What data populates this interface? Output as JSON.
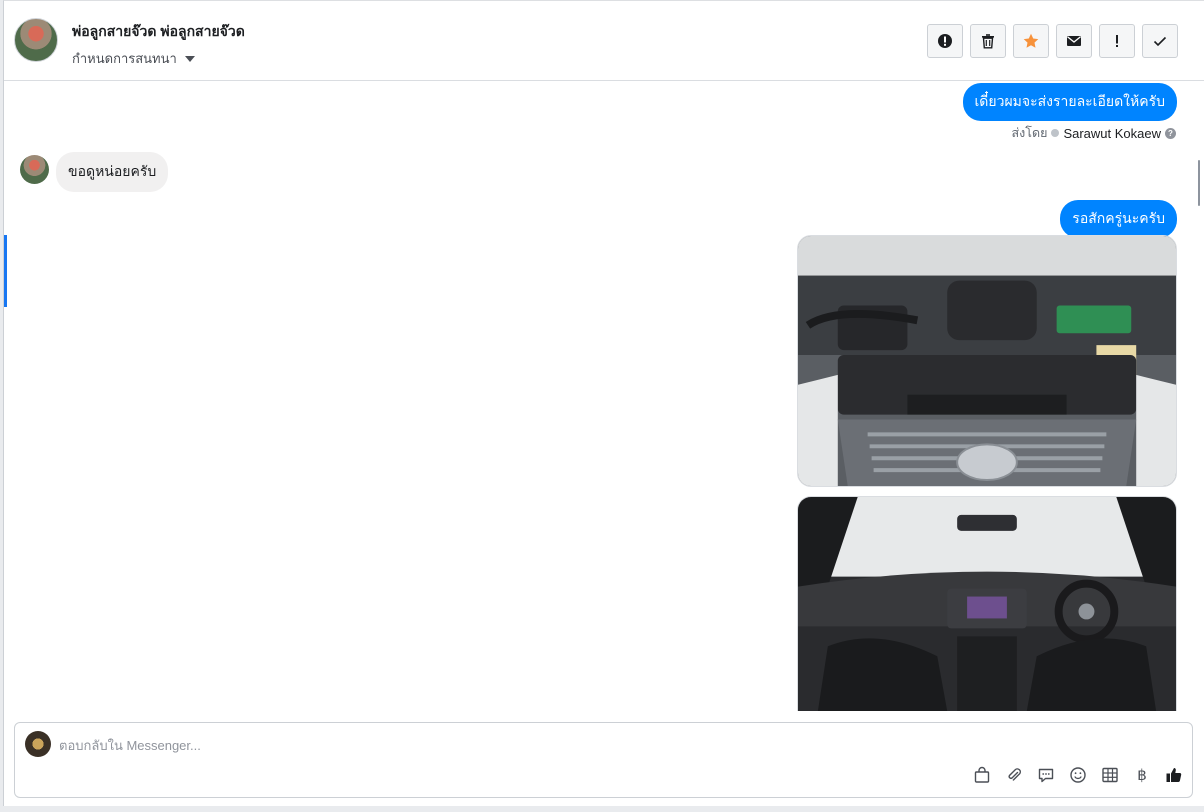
{
  "header": {
    "contact_name": "พ่อลูกสายจ๊วด พ่อลูกสายจ๊วด",
    "assign_label": "กำหนดการสนทนา",
    "actions": [
      {
        "icon": "spam-icon",
        "name": "spam-button"
      },
      {
        "icon": "trash-icon",
        "name": "delete-button"
      },
      {
        "icon": "star-icon",
        "name": "star-button"
      },
      {
        "icon": "envelope-icon",
        "name": "mark-unread-button"
      },
      {
        "icon": "exclamation-icon",
        "name": "follow-up-button"
      },
      {
        "icon": "check-icon",
        "name": "mark-done-button"
      }
    ],
    "star_color": "#f7923b"
  },
  "thread": {
    "messages": [
      {
        "direction": "outgoing",
        "text": "เดี๋ยวผมจะส่งรายละเอียดให้ครับ"
      },
      {
        "sent_by_label": "ส่งโดย",
        "agent_name": "Sarawut Kokaew"
      },
      {
        "direction": "incoming",
        "text": "ขอดูหน่อยครับ"
      },
      {
        "direction": "outgoing",
        "text": "รอสักครู่นะครับ"
      }
    ],
    "attachments": [
      {
        "type": "image",
        "subject": "engine-bay-photo"
      },
      {
        "type": "image",
        "subject": "car-interior-photo"
      }
    ]
  },
  "composer": {
    "placeholder": "ตอบกลับใน Messenger...",
    "tools": [
      "bag-icon",
      "paperclip-icon",
      "chat-bubble-icon",
      "smiley-icon",
      "table-icon",
      "baht-icon",
      "thumbs-up-icon"
    ]
  },
  "colors": {
    "outgoing_bubble": "#0084ff",
    "incoming_bubble": "#f1f0f0",
    "accent": "#1877f2"
  }
}
